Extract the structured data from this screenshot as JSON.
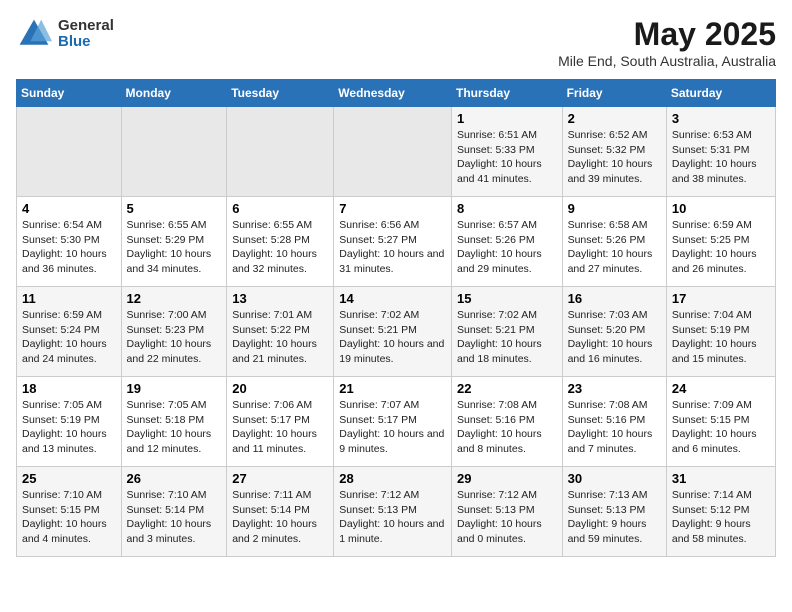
{
  "header": {
    "logo": {
      "line1": "General",
      "line2": "Blue"
    },
    "title": "May 2025",
    "location": "Mile End, South Australia, Australia"
  },
  "weekdays": [
    "Sunday",
    "Monday",
    "Tuesday",
    "Wednesday",
    "Thursday",
    "Friday",
    "Saturday"
  ],
  "weeks": [
    [
      {
        "day": "",
        "empty": true
      },
      {
        "day": "",
        "empty": true
      },
      {
        "day": "",
        "empty": true
      },
      {
        "day": "",
        "empty": true
      },
      {
        "day": "1",
        "sunrise": "6:51 AM",
        "sunset": "5:33 PM",
        "daylight": "10 hours and 41 minutes."
      },
      {
        "day": "2",
        "sunrise": "6:52 AM",
        "sunset": "5:32 PM",
        "daylight": "10 hours and 39 minutes."
      },
      {
        "day": "3",
        "sunrise": "6:53 AM",
        "sunset": "5:31 PM",
        "daylight": "10 hours and 38 minutes."
      }
    ],
    [
      {
        "day": "4",
        "sunrise": "6:54 AM",
        "sunset": "5:30 PM",
        "daylight": "10 hours and 36 minutes."
      },
      {
        "day": "5",
        "sunrise": "6:55 AM",
        "sunset": "5:29 PM",
        "daylight": "10 hours and 34 minutes."
      },
      {
        "day": "6",
        "sunrise": "6:55 AM",
        "sunset": "5:28 PM",
        "daylight": "10 hours and 32 minutes."
      },
      {
        "day": "7",
        "sunrise": "6:56 AM",
        "sunset": "5:27 PM",
        "daylight": "10 hours and 31 minutes."
      },
      {
        "day": "8",
        "sunrise": "6:57 AM",
        "sunset": "5:26 PM",
        "daylight": "10 hours and 29 minutes."
      },
      {
        "day": "9",
        "sunrise": "6:58 AM",
        "sunset": "5:26 PM",
        "daylight": "10 hours and 27 minutes."
      },
      {
        "day": "10",
        "sunrise": "6:59 AM",
        "sunset": "5:25 PM",
        "daylight": "10 hours and 26 minutes."
      }
    ],
    [
      {
        "day": "11",
        "sunrise": "6:59 AM",
        "sunset": "5:24 PM",
        "daylight": "10 hours and 24 minutes."
      },
      {
        "day": "12",
        "sunrise": "7:00 AM",
        "sunset": "5:23 PM",
        "daylight": "10 hours and 22 minutes."
      },
      {
        "day": "13",
        "sunrise": "7:01 AM",
        "sunset": "5:22 PM",
        "daylight": "10 hours and 21 minutes."
      },
      {
        "day": "14",
        "sunrise": "7:02 AM",
        "sunset": "5:21 PM",
        "daylight": "10 hours and 19 minutes."
      },
      {
        "day": "15",
        "sunrise": "7:02 AM",
        "sunset": "5:21 PM",
        "daylight": "10 hours and 18 minutes."
      },
      {
        "day": "16",
        "sunrise": "7:03 AM",
        "sunset": "5:20 PM",
        "daylight": "10 hours and 16 minutes."
      },
      {
        "day": "17",
        "sunrise": "7:04 AM",
        "sunset": "5:19 PM",
        "daylight": "10 hours and 15 minutes."
      }
    ],
    [
      {
        "day": "18",
        "sunrise": "7:05 AM",
        "sunset": "5:19 PM",
        "daylight": "10 hours and 13 minutes."
      },
      {
        "day": "19",
        "sunrise": "7:05 AM",
        "sunset": "5:18 PM",
        "daylight": "10 hours and 12 minutes."
      },
      {
        "day": "20",
        "sunrise": "7:06 AM",
        "sunset": "5:17 PM",
        "daylight": "10 hours and 11 minutes."
      },
      {
        "day": "21",
        "sunrise": "7:07 AM",
        "sunset": "5:17 PM",
        "daylight": "10 hours and 9 minutes."
      },
      {
        "day": "22",
        "sunrise": "7:08 AM",
        "sunset": "5:16 PM",
        "daylight": "10 hours and 8 minutes."
      },
      {
        "day": "23",
        "sunrise": "7:08 AM",
        "sunset": "5:16 PM",
        "daylight": "10 hours and 7 minutes."
      },
      {
        "day": "24",
        "sunrise": "7:09 AM",
        "sunset": "5:15 PM",
        "daylight": "10 hours and 6 minutes."
      }
    ],
    [
      {
        "day": "25",
        "sunrise": "7:10 AM",
        "sunset": "5:15 PM",
        "daylight": "10 hours and 4 minutes."
      },
      {
        "day": "26",
        "sunrise": "7:10 AM",
        "sunset": "5:14 PM",
        "daylight": "10 hours and 3 minutes."
      },
      {
        "day": "27",
        "sunrise": "7:11 AM",
        "sunset": "5:14 PM",
        "daylight": "10 hours and 2 minutes."
      },
      {
        "day": "28",
        "sunrise": "7:12 AM",
        "sunset": "5:13 PM",
        "daylight": "10 hours and 1 minute."
      },
      {
        "day": "29",
        "sunrise": "7:12 AM",
        "sunset": "5:13 PM",
        "daylight": "10 hours and 0 minutes."
      },
      {
        "day": "30",
        "sunrise": "7:13 AM",
        "sunset": "5:13 PM",
        "daylight": "9 hours and 59 minutes."
      },
      {
        "day": "31",
        "sunrise": "7:14 AM",
        "sunset": "5:12 PM",
        "daylight": "9 hours and 58 minutes."
      }
    ]
  ],
  "labels": {
    "sunrise": "Sunrise:",
    "sunset": "Sunset:",
    "daylight": "Daylight:"
  }
}
